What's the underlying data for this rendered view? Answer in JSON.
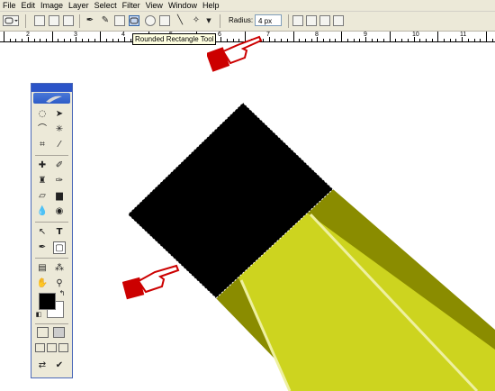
{
  "menu": {
    "items": [
      "File",
      "Edit",
      "Image",
      "Layer",
      "Select",
      "Filter",
      "View",
      "Window",
      "Help"
    ]
  },
  "options": {
    "radius_label": "Radius:",
    "radius_value": "4 px"
  },
  "tooltip": {
    "text": "Rounded Rectangle Tool"
  },
  "ruler": {
    "labels": [
      "2",
      "3",
      "4",
      "5",
      "6",
      "7",
      "8",
      "9",
      "10",
      "11"
    ]
  },
  "colors": {
    "foreground": "#000000",
    "background": "#ffffff",
    "pencil_dark": "#8a8c00",
    "pencil_light": "#cdd41f",
    "hand": "#cc0000"
  },
  "icons": {
    "tools": [
      "marquee-icon",
      "move-icon",
      "lasso-icon",
      "magic-wand-icon",
      "crop-icon",
      "slice-icon",
      "healing-brush-icon",
      "brush-icon",
      "clone-stamp-icon",
      "history-brush-icon",
      "eraser-icon",
      "gradient-icon",
      "blur-icon",
      "dodge-icon",
      "path-selection-icon",
      "type-icon",
      "pen-icon",
      "shape-icon",
      "notes-icon",
      "eyedropper-icon",
      "hand-icon",
      "zoom-icon"
    ]
  }
}
